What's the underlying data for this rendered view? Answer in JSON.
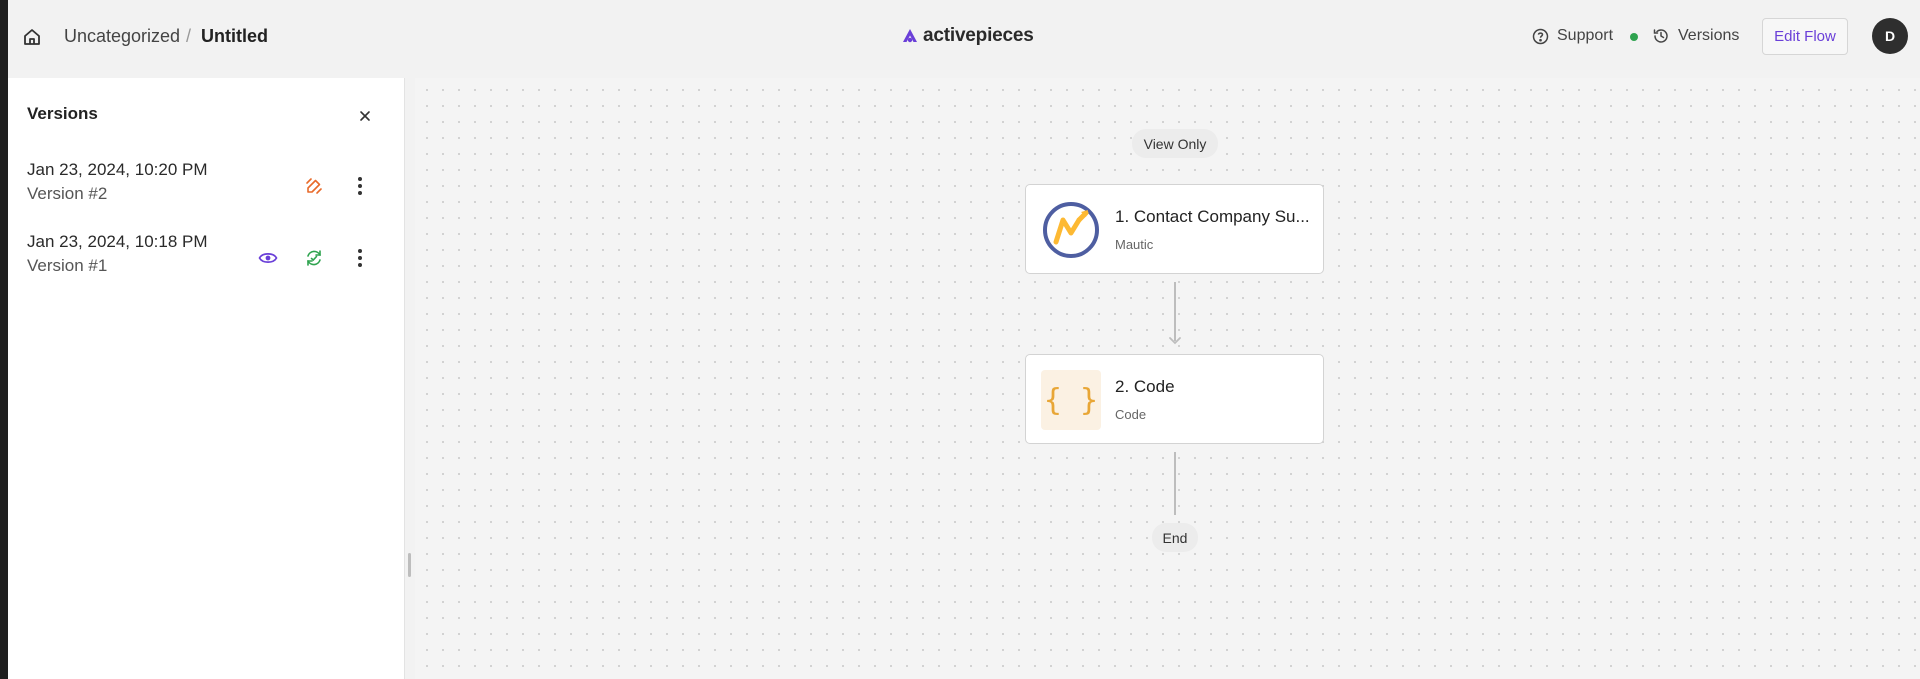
{
  "header": {
    "breadcrumb_folder": "Uncategorized",
    "breadcrumb_separator": "/",
    "flow_name": "Untitled",
    "brand": "activepieces",
    "support_label": "Support",
    "versions_label": "Versions",
    "edit_flow_label": "Edit Flow",
    "avatar_initial": "D"
  },
  "sidebar": {
    "title": "Versions",
    "versions": [
      {
        "date": "Jan 23, 2024, 10:20 PM",
        "name": "Version #2"
      },
      {
        "date": "Jan 23, 2024, 10:18 PM",
        "name": "Version #1"
      }
    ]
  },
  "canvas": {
    "badge": "View Only",
    "steps": [
      {
        "title": "1. Contact Company Su...",
        "subtitle": "Mautic",
        "icon": "mautic-logo"
      },
      {
        "title": "2. Code",
        "subtitle": "Code",
        "icon": "code-braces"
      }
    ],
    "end_label": "End",
    "code_glyph": "{ }"
  },
  "colors": {
    "brand_purple": "#6a3fd8",
    "draft_orange": "#e86a2a",
    "publish_green": "#2fa34f",
    "view_purple": "#6a3fd8",
    "code_accent": "#e8a636",
    "mautic_blue": "#4e5ea1",
    "mautic_orange": "#fdb933"
  }
}
